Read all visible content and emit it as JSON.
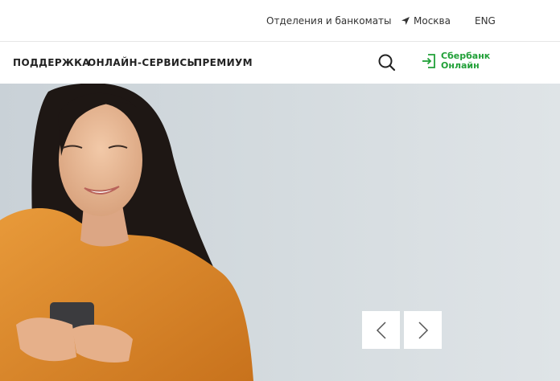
{
  "topbar": {
    "branches_label": "Отделения и банкоматы",
    "city_label": "Москва",
    "lang_label": "ENG"
  },
  "mainnav": {
    "support_label": "ПОДДЕРЖКА",
    "online_services_label": "ОНЛАЙН-СЕРВИСЫ",
    "premium_label": "ПРЕМИУМ"
  },
  "sbol": {
    "line1": "Сбербанк",
    "line2": "Онлайн",
    "icon": "login-arrow-icon"
  },
  "icons": {
    "city": "location-arrow-icon",
    "search": "search-icon",
    "prev": "chevron-left-icon",
    "next": "chevron-right-icon"
  },
  "colors": {
    "brand_green": "#21a038",
    "hero_background": "#d3dade",
    "sweater_orange": "#e08a2b"
  }
}
